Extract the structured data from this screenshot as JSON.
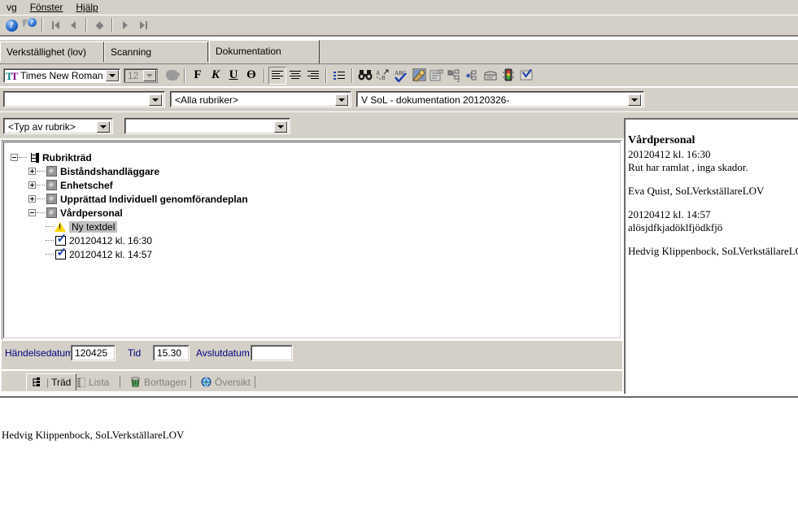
{
  "menu": {
    "items": [
      {
        "label": "vg",
        "truncated": true
      },
      {
        "label": "Fönster"
      },
      {
        "label": "Hjälp"
      }
    ]
  },
  "navbar": {
    "buttons": [
      {
        "name": "help-icon",
        "label": "?"
      },
      {
        "name": "help-pointer-icon",
        "label": "?"
      },
      {
        "name": "first-record-icon",
        "label": "|◀"
      },
      {
        "name": "previous-record-icon",
        "label": "◀"
      },
      {
        "name": "current-record-icon",
        "label": "◆"
      },
      {
        "name": "next-record-icon",
        "label": "▶"
      },
      {
        "name": "last-record-icon",
        "label": "▶|"
      }
    ]
  },
  "tabs": [
    {
      "label": "Verkställighet (lov)",
      "active": false
    },
    {
      "label": "Scanning",
      "active": false
    },
    {
      "label": "Dokumentation",
      "active": true
    }
  ],
  "formatbar": {
    "font_name": "Times New Roman",
    "font_size": "12",
    "bold_label": "F",
    "italic_label": "K",
    "underline_label": "U",
    "strike_label": "Ө",
    "icons": [
      "text-color-icon",
      "align-left-icon",
      "align-center-icon",
      "align-right-icon",
      "bullet-list-icon",
      "find-icon",
      "sort-icon",
      "spellcheck-icon",
      "highlighter-icon",
      "properties-icon",
      "copy-structure-icon",
      "add-node-icon",
      "template-icon",
      "traffic-light-icon",
      "sign-icon"
    ]
  },
  "filters": {
    "row1": {
      "left_value": "",
      "middle_value": "<Alla rubriker>",
      "right_value": "V SoL - dokumentation 20120326-"
    },
    "row2": {
      "type_value": "<Typ av rubrik>",
      "second_value": ""
    }
  },
  "tree": {
    "root": {
      "label": "Rubrikträd",
      "expanded": true
    },
    "nodes": [
      {
        "label": "Biståndshandläggare",
        "expanded": false,
        "icon": "sphere-icon",
        "level": 1
      },
      {
        "label": "Enhetschef",
        "expanded": false,
        "icon": "sphere-icon",
        "level": 1
      },
      {
        "label": "Upprättad Individuell genomförandeplan",
        "expanded": false,
        "icon": "sphere-icon",
        "level": 1
      },
      {
        "label": "Vårdpersonal",
        "expanded": true,
        "icon": "sphere-icon",
        "level": 1
      }
    ],
    "leaves": [
      {
        "label": "Ny textdel",
        "icon": "warning-icon",
        "selected": true
      },
      {
        "label": "20120412  kl. 16:30",
        "icon": "signed-note-icon",
        "selected": false
      },
      {
        "label": "20120412  kl. 14:57",
        "icon": "signed-note-icon",
        "selected": false
      }
    ]
  },
  "fields": {
    "event_date_label": "Händelsedatum",
    "event_date_value": "120425",
    "time_label": "Tid",
    "time_value": "15.30",
    "end_date_label": "Avslutdatum",
    "end_date_value": ""
  },
  "bottom_tabs": [
    {
      "label": "Träd",
      "icon": "tree-icon",
      "active": true
    },
    {
      "label": "Lista",
      "icon": "list-icon",
      "active": false
    },
    {
      "label": "Borttagen",
      "icon": "trash-icon",
      "active": false
    },
    {
      "label": "Översikt",
      "icon": "globe-icon",
      "active": false
    }
  ],
  "document": {
    "heading": "Vårdpersonal",
    "lines": [
      "20120412 kl. 16:30",
      "Rut har ramlat , inga skador.",
      "",
      "Eva Quist, SoLVerkställareLOV",
      "",
      "20120412 kl. 14:57",
      "alösjdfkjadöklfjödkfjö",
      "",
      "Hedvig Klippenbock, SoLVerkställareLOV"
    ]
  },
  "bottom_area": {
    "text": "Hedvig Klippenbock, SoLVerkställareLOV"
  },
  "colors": {
    "window_face": "#d4d0c8",
    "field_label": "#000080",
    "selection": "#c0c0c0",
    "warning": "#ffd800",
    "check_blue": "#1a3fb0"
  }
}
